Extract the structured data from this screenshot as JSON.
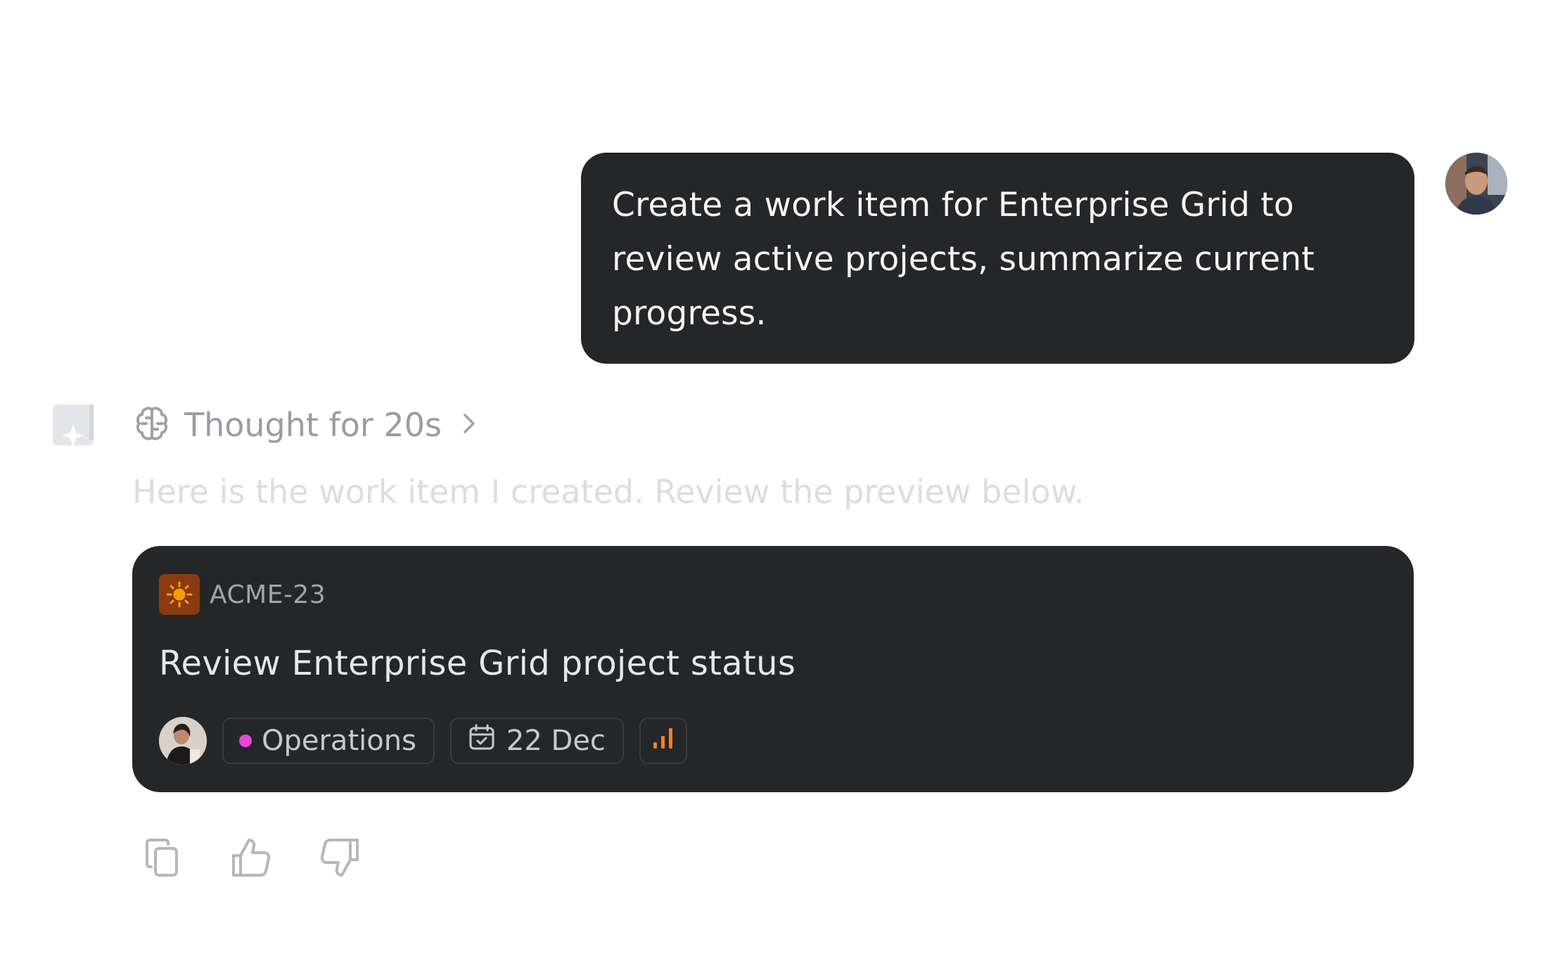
{
  "user_message": {
    "text": "Create a work item for Enterprise Grid to review active projects, summarize current progress.",
    "avatar_icon": "user-avatar"
  },
  "assistant": {
    "logo_icon": "assistant-logo-icon",
    "thought": {
      "label": "Thought for 20s",
      "icon": "brain-icon",
      "expand_icon": "chevron-right-icon"
    },
    "reply": "Here is the work item I created. Review the preview below."
  },
  "work_item": {
    "project_icon": "sun-icon",
    "project_icon_color": "#f59e0b",
    "id": "ACME-23",
    "title": "Review Enterprise Grid project status",
    "assignee_icon": "assignee-avatar",
    "team": {
      "label": "Operations",
      "color": "#e946d8"
    },
    "due_date": {
      "label": "22 Dec",
      "icon": "calendar-icon"
    },
    "priority": {
      "icon": "priority-bars-icon",
      "color": "#f0822a",
      "level": "high"
    }
  },
  "feedback_actions": [
    {
      "name": "copy",
      "icon": "copy-icon"
    },
    {
      "name": "thumbs-up",
      "icon": "thumbs-up-icon"
    },
    {
      "name": "thumbs-down",
      "icon": "thumbs-down-icon"
    }
  ]
}
